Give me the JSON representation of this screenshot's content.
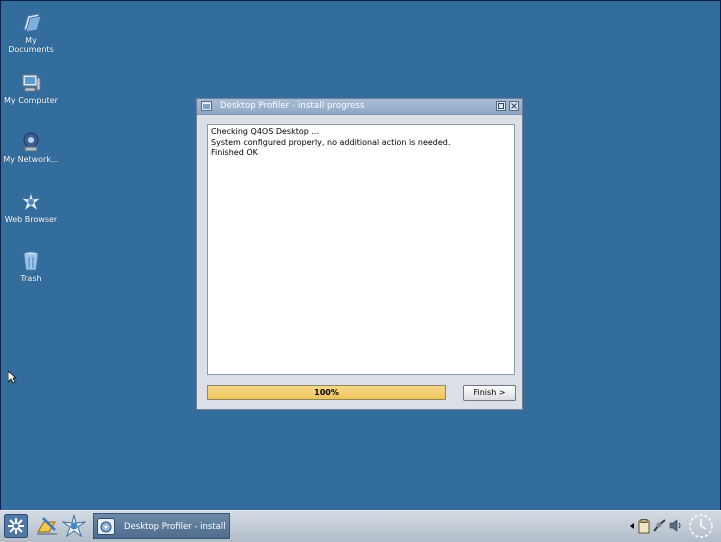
{
  "desktop": {
    "icons": [
      {
        "label": "My Documents",
        "icon": "documents-icon"
      },
      {
        "label": "My Computer",
        "icon": "computer-icon"
      },
      {
        "label": "My Network...",
        "icon": "network-icon"
      },
      {
        "label": "Web Browser",
        "icon": "browser-icon"
      },
      {
        "label": "Trash",
        "icon": "trash-icon"
      }
    ],
    "background_color": "#336d9d"
  },
  "window": {
    "title": "Desktop Profiler - install progress",
    "log_lines": [
      "Checking Q4OS Desktop ...",
      "System configured properly, no additional action is needed.",
      "Finished OK"
    ],
    "progress_label": "100%",
    "progress_value": 1.0,
    "finish_button": "Finish >"
  },
  "taskbar": {
    "task_label": "Desktop Profiler - install pr"
  },
  "colors": {
    "progress_fill": "#efc45b",
    "task_item": "#5a7697"
  }
}
